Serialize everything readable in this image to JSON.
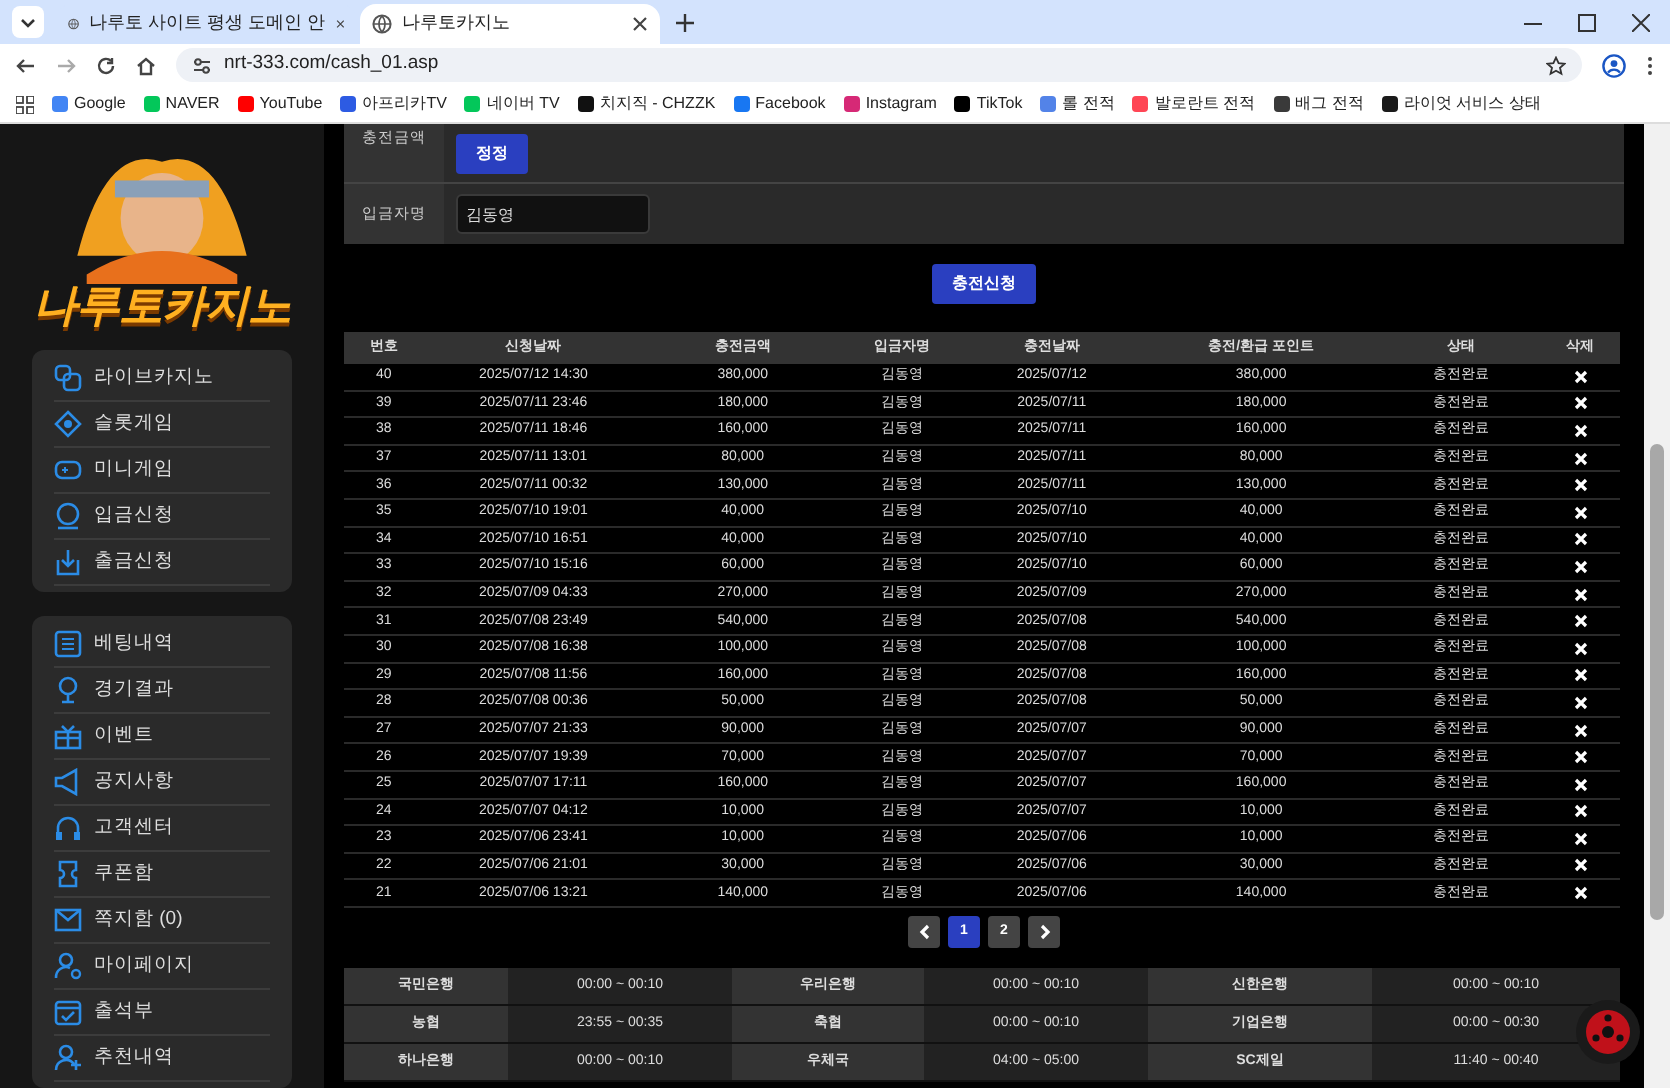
{
  "browser": {
    "tabs": [
      {
        "title": "나루토 사이트 평생 도메인 안",
        "selected": false
      },
      {
        "title": "나루토카지노",
        "selected": true
      }
    ],
    "url": "nrt-333.com/cash_01.asp",
    "bookmarks": [
      {
        "label": "Google",
        "color": "#4285f4"
      },
      {
        "label": "NAVER",
        "color": "#03c75a"
      },
      {
        "label": "YouTube",
        "color": "#ff0000"
      },
      {
        "label": "아프리카TV",
        "color": "#2d5be3"
      },
      {
        "label": "네이버 TV",
        "color": "#03c75a"
      },
      {
        "label": "치지직 - CHZZK",
        "color": "#111111"
      },
      {
        "label": "Facebook",
        "color": "#1877f2"
      },
      {
        "label": "Instagram",
        "color": "#d62976"
      },
      {
        "label": "TikTok",
        "color": "#000000"
      },
      {
        "label": "롤 전적",
        "color": "#5383e8"
      },
      {
        "label": "발로란트 전적",
        "color": "#ff4655"
      },
      {
        "label": "배그 전적",
        "color": "#3a3a3a"
      },
      {
        "label": "라이엇 서비스 상태",
        "color": "#1a1a1a"
      }
    ]
  },
  "logo": {
    "text": "나루토카지노"
  },
  "sidebar": {
    "groups": [
      [
        {
          "label": "라이브카지노"
        },
        {
          "label": "슬롯게임"
        },
        {
          "label": "미니게임"
        },
        {
          "label": "입금신청"
        },
        {
          "label": "출금신청"
        }
      ],
      [
        {
          "label": "베팅내역"
        },
        {
          "label": "경기결과"
        },
        {
          "label": "이벤트"
        },
        {
          "label": "공지사항"
        },
        {
          "label": "고객센터"
        },
        {
          "label": "쿠폰함"
        },
        {
          "label": "쪽지함 (0)"
        },
        {
          "label": "마이페이지"
        },
        {
          "label": "출석부"
        },
        {
          "label": "추천내역"
        }
      ]
    ]
  },
  "form": {
    "amount_label": "충전금액",
    "reset_button": "정정",
    "depositor_label": "입금자명",
    "depositor_value": "김동영",
    "submit_button": "충전신청"
  },
  "table": {
    "columns": [
      "번호",
      "신청날짜",
      "충전금액",
      "입금자명",
      "충전날짜",
      "충전/환급 포인트",
      "상태",
      "삭제"
    ],
    "rows": [
      [
        "40",
        "2025/07/12 14:30",
        "380,000",
        "김동영",
        "2025/07/12",
        "380,000",
        "충전완료"
      ],
      [
        "39",
        "2025/07/11 23:46",
        "180,000",
        "김동영",
        "2025/07/11",
        "180,000",
        "충전완료"
      ],
      [
        "38",
        "2025/07/11 18:46",
        "160,000",
        "김동영",
        "2025/07/11",
        "160,000",
        "충전완료"
      ],
      [
        "37",
        "2025/07/11 13:01",
        "80,000",
        "김동영",
        "2025/07/11",
        "80,000",
        "충전완료"
      ],
      [
        "36",
        "2025/07/11 00:32",
        "130,000",
        "김동영",
        "2025/07/11",
        "130,000",
        "충전완료"
      ],
      [
        "35",
        "2025/07/10 19:01",
        "40,000",
        "김동영",
        "2025/07/10",
        "40,000",
        "충전완료"
      ],
      [
        "34",
        "2025/07/10 16:51",
        "40,000",
        "김동영",
        "2025/07/10",
        "40,000",
        "충전완료"
      ],
      [
        "33",
        "2025/07/10 15:16",
        "60,000",
        "김동영",
        "2025/07/10",
        "60,000",
        "충전완료"
      ],
      [
        "32",
        "2025/07/09 04:33",
        "270,000",
        "김동영",
        "2025/07/09",
        "270,000",
        "충전완료"
      ],
      [
        "31",
        "2025/07/08 23:49",
        "540,000",
        "김동영",
        "2025/07/08",
        "540,000",
        "충전완료"
      ],
      [
        "30",
        "2025/07/08 16:38",
        "100,000",
        "김동영",
        "2025/07/08",
        "100,000",
        "충전완료"
      ],
      [
        "29",
        "2025/07/08 11:56",
        "160,000",
        "김동영",
        "2025/07/08",
        "160,000",
        "충전완료"
      ],
      [
        "28",
        "2025/07/08 00:36",
        "50,000",
        "김동영",
        "2025/07/08",
        "50,000",
        "충전완료"
      ],
      [
        "27",
        "2025/07/07 21:33",
        "90,000",
        "김동영",
        "2025/07/07",
        "90,000",
        "충전완료"
      ],
      [
        "26",
        "2025/07/07 19:39",
        "70,000",
        "김동영",
        "2025/07/07",
        "70,000",
        "충전완료"
      ],
      [
        "25",
        "2025/07/07 17:11",
        "160,000",
        "김동영",
        "2025/07/07",
        "160,000",
        "충전완료"
      ],
      [
        "24",
        "2025/07/07 04:12",
        "10,000",
        "김동영",
        "2025/07/07",
        "10,000",
        "충전완료"
      ],
      [
        "23",
        "2025/07/06 23:41",
        "10,000",
        "김동영",
        "2025/07/06",
        "10,000",
        "충전완료"
      ],
      [
        "22",
        "2025/07/06 21:01",
        "30,000",
        "김동영",
        "2025/07/06",
        "30,000",
        "충전완료"
      ],
      [
        "21",
        "2025/07/06 13:21",
        "140,000",
        "김동영",
        "2025/07/06",
        "140,000",
        "충전완료"
      ]
    ]
  },
  "pagination": [
    {
      "label": "1",
      "selected": true
    },
    {
      "label": "2",
      "selected": false
    }
  ],
  "banks": [
    [
      "국민은행",
      "00:00 ~ 00:10",
      "우리은행",
      "00:00 ~ 00:10",
      "신한은행",
      "00:00 ~ 00:10"
    ],
    [
      "농협",
      "23:55 ~ 00:35",
      "축협",
      "00:00 ~ 00:10",
      "기업은행",
      "00:00 ~ 00:30"
    ],
    [
      "하나은행",
      "00:00 ~ 00:10",
      "우체국",
      "04:00 ~ 05:00",
      "SC제일",
      "11:40 ~ 00:40"
    ]
  ]
}
